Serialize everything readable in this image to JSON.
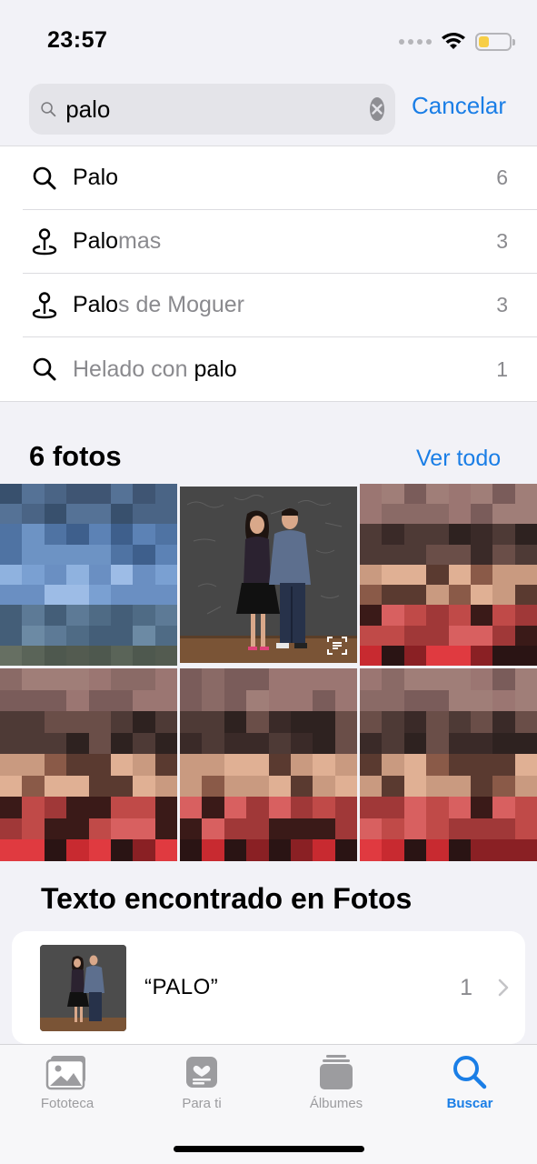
{
  "status_bar": {
    "time": "23:57",
    "battery_level": 0.35
  },
  "search": {
    "value": "palo",
    "cancel_label": "Cancelar"
  },
  "suggestions": [
    {
      "icon": "search-icon",
      "match": "Palo",
      "rest": "",
      "match_first": true,
      "count": "6"
    },
    {
      "icon": "location-pin-icon",
      "match": "Palo",
      "rest": "mas",
      "match_first": true,
      "count": "3"
    },
    {
      "icon": "location-pin-icon",
      "match": "Palo",
      "rest": "s de Moguer",
      "match_first": true,
      "count": "3"
    },
    {
      "icon": "search-icon",
      "prefix": "Helado con ",
      "match": "palo",
      "match_first": false,
      "count": "1"
    }
  ],
  "photos": {
    "title": "6 fotos",
    "see_all": "Ver todo"
  },
  "text_found": {
    "title": "Texto encontrado en Fotos",
    "item_text": "“PALO”",
    "item_count": "1"
  },
  "tabs": [
    {
      "label": "Fototeca",
      "icon": "photos-library-icon",
      "active": false
    },
    {
      "label": "Para ti",
      "icon": "for-you-icon",
      "active": false
    },
    {
      "label": "Álbumes",
      "icon": "albums-icon",
      "active": false
    },
    {
      "label": "Buscar",
      "icon": "search-icon",
      "active": true
    }
  ],
  "colors": {
    "accent": "#1a7ee6",
    "secondary_text": "#8a8a8e",
    "background": "#f2f2f7"
  }
}
